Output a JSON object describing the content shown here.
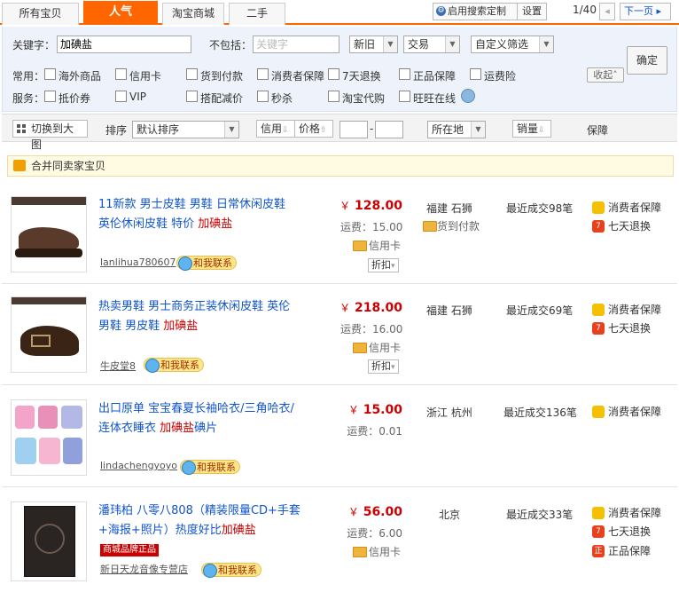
{
  "tabs": [
    "所有宝贝",
    "人气",
    "淘宝商城",
    "二手"
  ],
  "top_actions": {
    "custom_search": "启用搜索定制",
    "settings": "设置",
    "page": "1/40",
    "next": "下一页"
  },
  "filters": {
    "keyword_label": "关键字：",
    "keyword_value": "加碘盐",
    "exclude_label": "不包括：",
    "exclude_placeholder": "关键字",
    "condition": "新旧",
    "trade": "交易",
    "custom": "自定义筛选",
    "confirm": "确定",
    "common_label": "常用：",
    "service_label": "服务：",
    "collapse": "收起",
    "common": [
      "海外商品",
      "信用卡",
      "货到付款",
      "消费者保障",
      "7天退换",
      "正品保障",
      "运费险"
    ],
    "service": [
      "抵价券",
      "VIP",
      "搭配减价",
      "秒杀",
      "淘宝代购",
      "旺旺在线"
    ]
  },
  "sortbar": {
    "bigimg": "切换到大图",
    "sort_label": "排序",
    "sort_value": "默认排序",
    "credit": "信用",
    "price": "价格",
    "dash": "-",
    "location": "所在地",
    "sales": "销量",
    "guarantee": "保障"
  },
  "merge_label": "合并同卖家宝贝",
  "contact": "和我联系",
  "items": [
    {
      "t1": "11新款 男士皮鞋 男鞋 日常休闲皮鞋",
      "t2": "英伦休闲皮鞋 特价 ",
      "hl": "加碘盐",
      "t3": "",
      "seller": "lanlihua780607",
      "price": "128.00",
      "ship": "运费：15.00",
      "cc": "信用卡",
      "cod": "货到付款",
      "zk": "折扣",
      "loc": "福建 石狮",
      "sold": "最近成交98笔",
      "g": [
        "消费者保障",
        "七天退换"
      ]
    },
    {
      "t1": "热卖男鞋 男士商务正装休闲皮鞋 英伦",
      "t2": "男鞋 男皮鞋 ",
      "hl": "加碘盐",
      "t3": "",
      "seller": "牛皮堂8",
      "price": "218.00",
      "ship": "运费：16.00",
      "cc": "信用卡",
      "zk": "折扣",
      "loc": "福建 石狮",
      "sold": "最近成交69笔",
      "g": [
        "消费者保障",
        "七天退换"
      ]
    },
    {
      "t1": "出口原单 宝宝春夏长袖哈衣/三角哈衣/",
      "t2": "连体衣睡衣 ",
      "hl": "加碘盐",
      "t3": "碘片",
      "seller": "lindachengyoyo",
      "price": "15.00",
      "ship": "运费：0.01",
      "loc": "浙江 杭州",
      "sold": "最近成交136笔",
      "g": [
        "消费者保障"
      ]
    },
    {
      "t1": "潘玮柏 八零八808（精装限量CD+手套",
      "t2": "+海报+照片）热度好比",
      "hl": "加碘盐",
      "t3": "",
      "brand": "商城品牌正品",
      "seller": "新日天龙音像专营店",
      "price": "56.00",
      "ship": "运费：6.00",
      "cc": "信用卡",
      "loc": "北京",
      "sold": "最近成交33笔",
      "g": [
        "消费者保障",
        "七天退换",
        "正品保障"
      ]
    }
  ],
  "yen": "￥"
}
